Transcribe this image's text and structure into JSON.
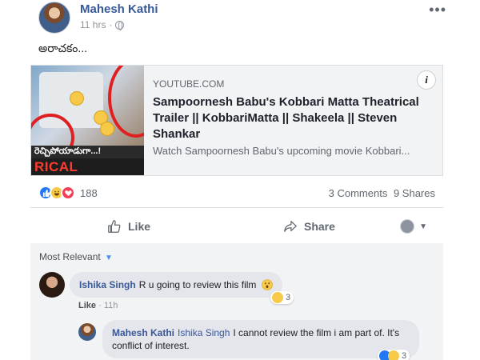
{
  "post": {
    "author": "Mahesh Kathi",
    "time": "11 hrs",
    "text": "అరాచకం...",
    "more_glyph": "•••"
  },
  "link": {
    "thumbnail_caption_telugu": "రెచ్చిపోయాడుగా...!",
    "thumbnail_caption_trailer": "RICAL TRAILER",
    "domain": "YOUTUBE.COM",
    "title": "Sampoornesh Babu's Kobbari Matta Theatrical Trailer || KobbariMatta || Shakeela || Steven Shankar",
    "description": "Watch Sampoornesh Babu's upcoming movie Kobbari...",
    "info_glyph": "i"
  },
  "reactions": {
    "count": "188",
    "comments": "3 Comments",
    "shares": "9 Shares"
  },
  "actions": {
    "like": "Like",
    "share": "Share"
  },
  "comments": {
    "sort_label": "Most Relevant",
    "items": [
      {
        "author": "Ishika Singh",
        "mention": "",
        "text": "R u going to review this film",
        "like": "Like",
        "time": "11h",
        "reaction_count": "3"
      },
      {
        "author": "Mahesh Kathi",
        "mention": "Ishika Singh",
        "text": "I cannot review the film i am part of. It's conflict of interest.",
        "reaction_count": "3"
      }
    ]
  },
  "colors": {
    "link_blue": "#365899",
    "like_blue": "#2078f4",
    "love_red": "#f33e58",
    "haha_yellow": "#f7c948",
    "thumb_red": "#e02020"
  }
}
